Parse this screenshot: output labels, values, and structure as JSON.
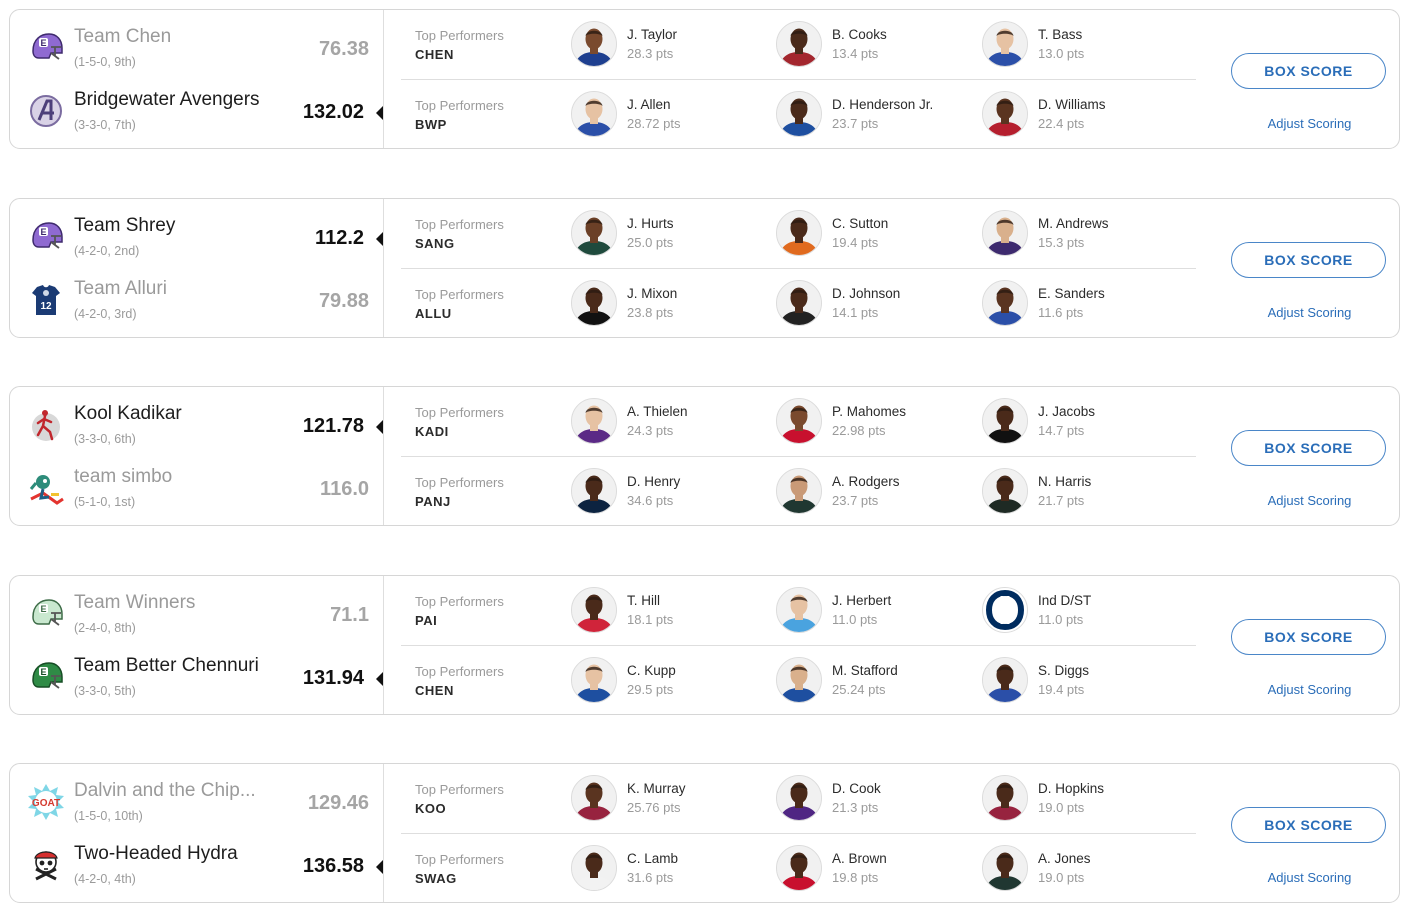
{
  "matchups": [
    {
      "teams": [
        {
          "name": "Team Chen",
          "record": "(1-5-0, 9th)",
          "score": "76.38",
          "result": "loser",
          "logo": "helmet-purple-icon"
        },
        {
          "name": "Bridgewater Avengers",
          "record": "(3-3-0, 7th)",
          "score": "132.02",
          "result": "winner",
          "logo": "avengers-logo-icon"
        }
      ],
      "rows": [
        {
          "label": "Top Performers",
          "abbr": "CHEN",
          "players": [
            {
              "name": "J. Taylor",
              "pts": "28.3 pts",
              "jersey": "#1e3f8f",
              "skin": "#7a4a2e"
            },
            {
              "name": "B. Cooks",
              "pts": "13.4 pts",
              "jersey": "#a3262e",
              "skin": "#4a2a1a"
            },
            {
              "name": "T. Bass",
              "pts": "13.0 pts",
              "jersey": "#2b4fa8",
              "skin": "#e6c2a3"
            }
          ]
        },
        {
          "label": "Top Performers",
          "abbr": "BWP",
          "players": [
            {
              "name": "J. Allen",
              "pts": "28.72 pts",
              "jersey": "#2b4fa8",
              "skin": "#e6c2a3"
            },
            {
              "name": "D. Henderson Jr.",
              "pts": "23.7 pts",
              "jersey": "#1e4fa0",
              "skin": "#4a2a1a"
            },
            {
              "name": "D. Williams",
              "pts": "22.4 pts",
              "jersey": "#b51f2e",
              "skin": "#5a3420"
            }
          ]
        }
      ],
      "box_score": "BOX SCORE",
      "adjust": "Adjust Scoring"
    },
    {
      "teams": [
        {
          "name": "Team Shrey",
          "record": "(4-2-0, 2nd)",
          "score": "112.2",
          "result": "winner",
          "logo": "helmet-purple-icon"
        },
        {
          "name": "Team Alluri",
          "record": "(4-2-0, 3rd)",
          "score": "79.88",
          "result": "loser",
          "logo": "jersey-12-icon"
        }
      ],
      "rows": [
        {
          "label": "Top Performers",
          "abbr": "SANG",
          "players": [
            {
              "name": "J. Hurts",
              "pts": "25.0 pts",
              "jersey": "#1f4a3d",
              "skin": "#6b4027"
            },
            {
              "name": "C. Sutton",
              "pts": "19.4 pts",
              "jersey": "#e06a1f",
              "skin": "#4a2a1a"
            },
            {
              "name": "M. Andrews",
              "pts": "15.3 pts",
              "jersey": "#3d2a6e",
              "skin": "#d9b08c"
            }
          ]
        },
        {
          "label": "Top Performers",
          "abbr": "ALLU",
          "players": [
            {
              "name": "J. Mixon",
              "pts": "23.8 pts",
              "jersey": "#111111",
              "skin": "#4a2a1a"
            },
            {
              "name": "D. Johnson",
              "pts": "14.1 pts",
              "jersey": "#222222",
              "skin": "#4a2a1a"
            },
            {
              "name": "E. Sanders",
              "pts": "11.6 pts",
              "jersey": "#2b4fa8",
              "skin": "#5a3420"
            }
          ]
        }
      ],
      "box_score": "BOX SCORE",
      "adjust": "Adjust Scoring"
    },
    {
      "teams": [
        {
          "name": "Kool Kadikar",
          "record": "(3-3-0, 6th)",
          "score": "121.78",
          "result": "winner",
          "logo": "runner-circle-icon"
        },
        {
          "name": "team simbo",
          "record": "(5-1-0, 1st)",
          "score": "116.0",
          "result": "loser",
          "logo": "cartoon-mascot-icon"
        }
      ],
      "rows": [
        {
          "label": "Top Performers",
          "abbr": "KADI",
          "players": [
            {
              "name": "A. Thielen",
              "pts": "24.3 pts",
              "jersey": "#5b2a86",
              "skin": "#e6c2a3"
            },
            {
              "name": "P. Mahomes",
              "pts": "22.98 pts",
              "jersey": "#c8102e",
              "skin": "#7a4a2e"
            },
            {
              "name": "J. Jacobs",
              "pts": "14.7 pts",
              "jersey": "#111111",
              "skin": "#4a2a1a"
            }
          ]
        },
        {
          "label": "Top Performers",
          "abbr": "PANJ",
          "players": [
            {
              "name": "D. Henry",
              "pts": "34.6 pts",
              "jersey": "#0c2340",
              "skin": "#4a2a1a"
            },
            {
              "name": "A. Rodgers",
              "pts": "23.7 pts",
              "jersey": "#203731",
              "skin": "#c99a77"
            },
            {
              "name": "N. Harris",
              "pts": "21.7 pts",
              "jersey": "#1e2a24",
              "skin": "#4a2a1a"
            }
          ]
        }
      ],
      "box_score": "BOX SCORE",
      "adjust": "Adjust Scoring"
    },
    {
      "teams": [
        {
          "name": "Team Winners",
          "record": "(2-4-0, 8th)",
          "score": "71.1",
          "result": "loser",
          "logo": "helmet-lightgreen-icon"
        },
        {
          "name": "Team Better Chennuri",
          "record": "(3-3-0, 5th)",
          "score": "131.94",
          "result": "winner",
          "logo": "helmet-green-icon"
        }
      ],
      "rows": [
        {
          "label": "Top Performers",
          "abbr": "PAI",
          "players": [
            {
              "name": "T. Hill",
              "pts": "18.1 pts",
              "jersey": "#d0243a",
              "skin": "#4a2a1a"
            },
            {
              "name": "J. Herbert",
              "pts": "11.0 pts",
              "jersey": "#4aa3df",
              "skin": "#e6c2a3"
            },
            {
              "name": "Ind D/ST",
              "pts": "11.0 pts",
              "jersey": "#002c5f",
              "skin": "",
              "dst": true
            }
          ]
        },
        {
          "label": "Top Performers",
          "abbr": "CHEN",
          "players": [
            {
              "name": "C. Kupp",
              "pts": "29.5 pts",
              "jersey": "#1e4fa0",
              "skin": "#e6c2a3"
            },
            {
              "name": "M. Stafford",
              "pts": "25.24 pts",
              "jersey": "#1e4fa0",
              "skin": "#d9b08c"
            },
            {
              "name": "S. Diggs",
              "pts": "19.4 pts",
              "jersey": "#2b4fa8",
              "skin": "#4a2a1a"
            }
          ]
        }
      ],
      "box_score": "BOX SCORE",
      "adjust": "Adjust Scoring"
    },
    {
      "teams": [
        {
          "name": "Dalvin and the Chip...",
          "record": "(1-5-0, 10th)",
          "score": "129.46",
          "result": "loser",
          "logo": "goat-burst-icon"
        },
        {
          "name": "Two-Headed Hydra",
          "record": "(4-2-0, 4th)",
          "score": "136.58",
          "result": "winner",
          "logo": "skull-pirate-icon"
        }
      ],
      "rows": [
        {
          "label": "Top Performers",
          "abbr": "KOO",
          "players": [
            {
              "name": "K. Murray",
              "pts": "25.76 pts",
              "jersey": "#97233f",
              "skin": "#5a3420"
            },
            {
              "name": "D. Cook",
              "pts": "21.3 pts",
              "jersey": "#4f2683",
              "skin": "#4a2a1a"
            },
            {
              "name": "D. Hopkins",
              "pts": "19.0 pts",
              "jersey": "#97233f",
              "skin": "#4a2a1a"
            }
          ]
        },
        {
          "label": "Top Performers",
          "abbr": "SWAG",
          "players": [
            {
              "name": "C. Lamb",
              "pts": "31.6 pts",
              "jersey": "#f2f2f2",
              "skin": "#4a2a1a"
            },
            {
              "name": "A. Brown",
              "pts": "19.8 pts",
              "jersey": "#c8102e",
              "skin": "#4a2a1a"
            },
            {
              "name": "A. Jones",
              "pts": "19.0 pts",
              "jersey": "#203731",
              "skin": "#4a2a1a"
            }
          ]
        }
      ],
      "box_score": "BOX SCORE",
      "adjust": "Adjust Scoring"
    }
  ]
}
